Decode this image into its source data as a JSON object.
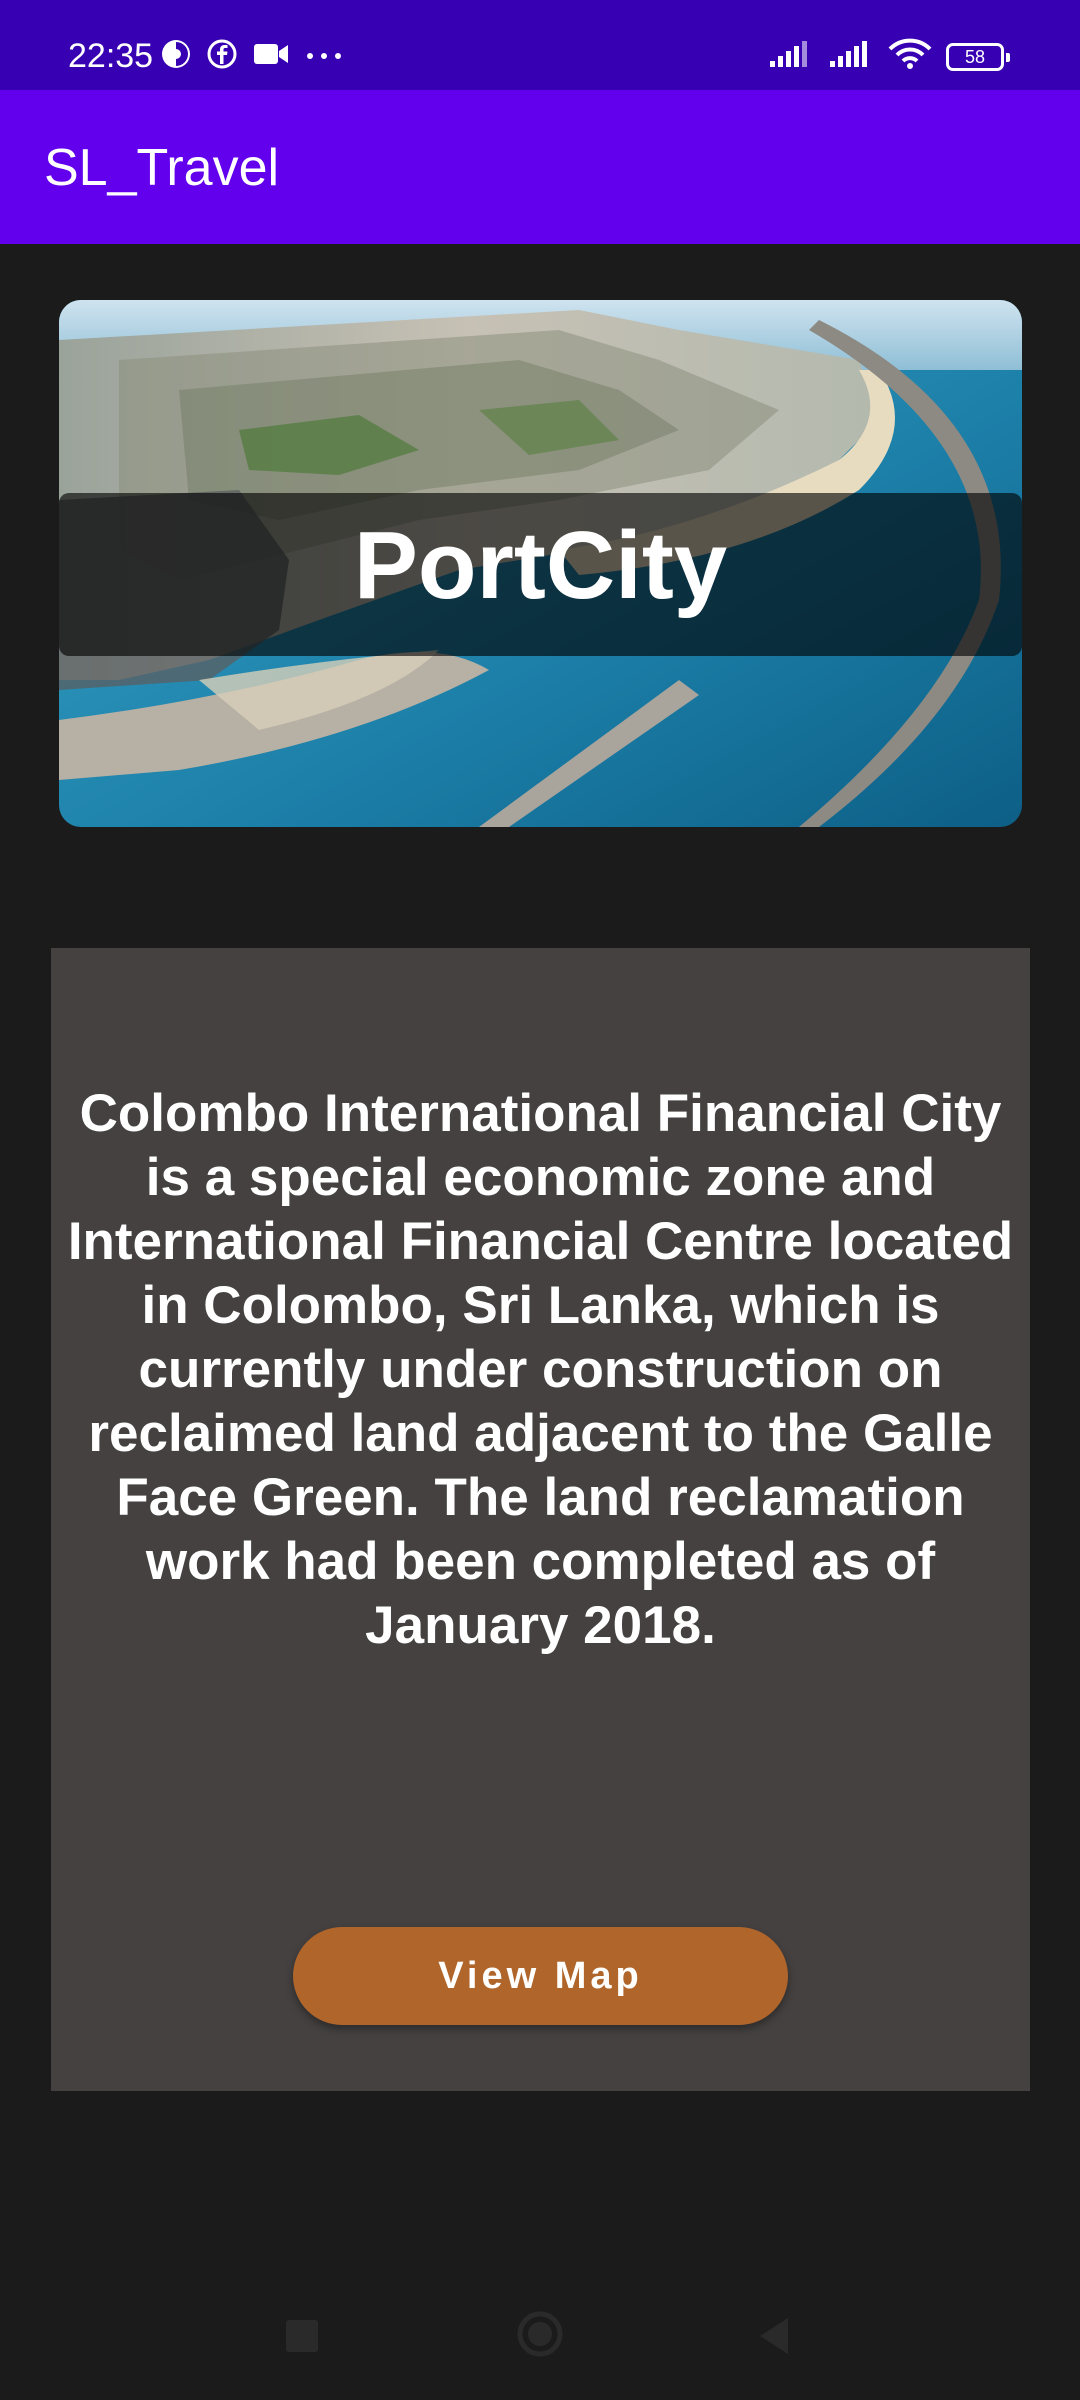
{
  "status_bar": {
    "time": "22:35",
    "battery_level": "58",
    "icons": [
      "data-saver-icon",
      "facebook-icon",
      "video-camera-icon",
      "more-dots-icon",
      "signal-icon",
      "signal-icon",
      "wifi-icon",
      "battery-icon"
    ]
  },
  "app_bar": {
    "title": "SL_Travel",
    "color": "#6200ee"
  },
  "hero": {
    "title": "PortCity",
    "image": "aerial-city-waterfront-photo"
  },
  "description": {
    "text": "Colombo International Financial City is a special economic zone and International Financial Centre located in Colombo, Sri Lanka, which is currently under construction on reclaimed land adjacent to the Galle Face Green. The land reclamation work had been completed as of January 2018."
  },
  "actions": {
    "view_map_label": "View Map",
    "button_color": "#b0652a"
  },
  "nav_bar": {
    "buttons": [
      "recent-apps-icon",
      "home-icon",
      "back-icon"
    ]
  }
}
